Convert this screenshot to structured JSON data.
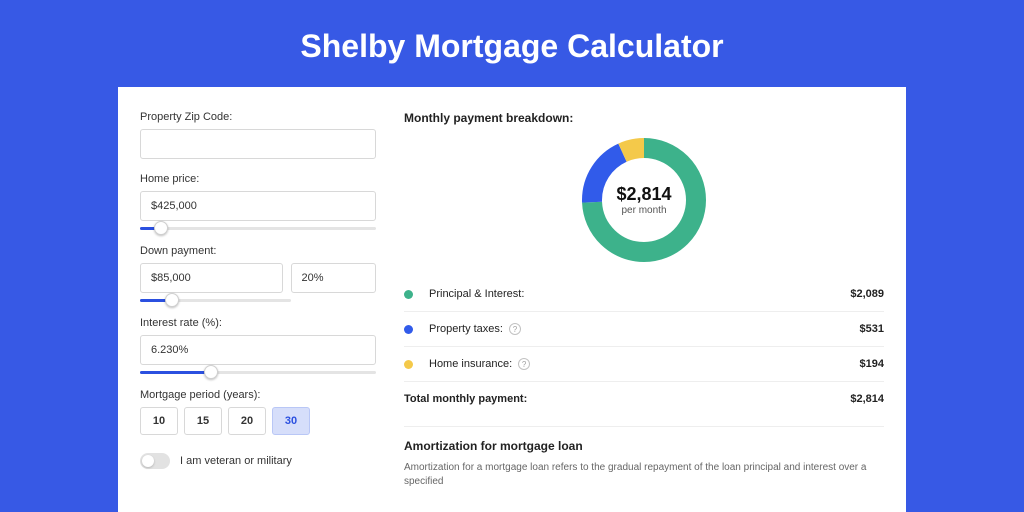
{
  "title": "Shelby Mortgage Calculator",
  "colors": {
    "accent": "#2b50e0",
    "green": "#3db28b",
    "yellow": "#f4c94a",
    "blue": "#315bea"
  },
  "left": {
    "zip_label": "Property Zip Code:",
    "zip_value": "",
    "home_price_label": "Home price:",
    "home_price_value": "$425,000",
    "home_price_slider_pct": 9,
    "down_label": "Down payment:",
    "down_value": "$85,000",
    "down_pct": "20%",
    "down_slider_pct": 21,
    "rate_label": "Interest rate (%):",
    "rate_value": "6.230%",
    "rate_slider_pct": 30,
    "period_label": "Mortgage period (years):",
    "periods": [
      "10",
      "15",
      "20",
      "30"
    ],
    "period_active": 3,
    "vet_label": "I am veteran or military"
  },
  "right": {
    "header": "Monthly payment breakdown:",
    "center_value": "$2,814",
    "center_sub": "per month",
    "items": [
      {
        "label": "Principal & Interest:",
        "amount": "$2,089",
        "color": "#3db28b",
        "info": false
      },
      {
        "label": "Property taxes:",
        "amount": "$531",
        "color": "#315bea",
        "info": true
      },
      {
        "label": "Home insurance:",
        "amount": "$194",
        "color": "#f4c94a",
        "info": true
      }
    ],
    "total_label": "Total monthly payment:",
    "total_amount": "$2,814",
    "amort_header": "Amortization for mortgage loan",
    "amort_text": "Amortization for a mortgage loan refers to the gradual repayment of the loan principal and interest over a specified"
  },
  "chart_data": {
    "type": "pie",
    "title": "Monthly payment breakdown",
    "series": [
      {
        "name": "Principal & Interest",
        "value": 2089,
        "color": "#3db28b"
      },
      {
        "name": "Property taxes",
        "value": 531,
        "color": "#315bea"
      },
      {
        "name": "Home insurance",
        "value": 194,
        "color": "#f4c94a"
      }
    ],
    "center_label": "$2,814 per month"
  }
}
